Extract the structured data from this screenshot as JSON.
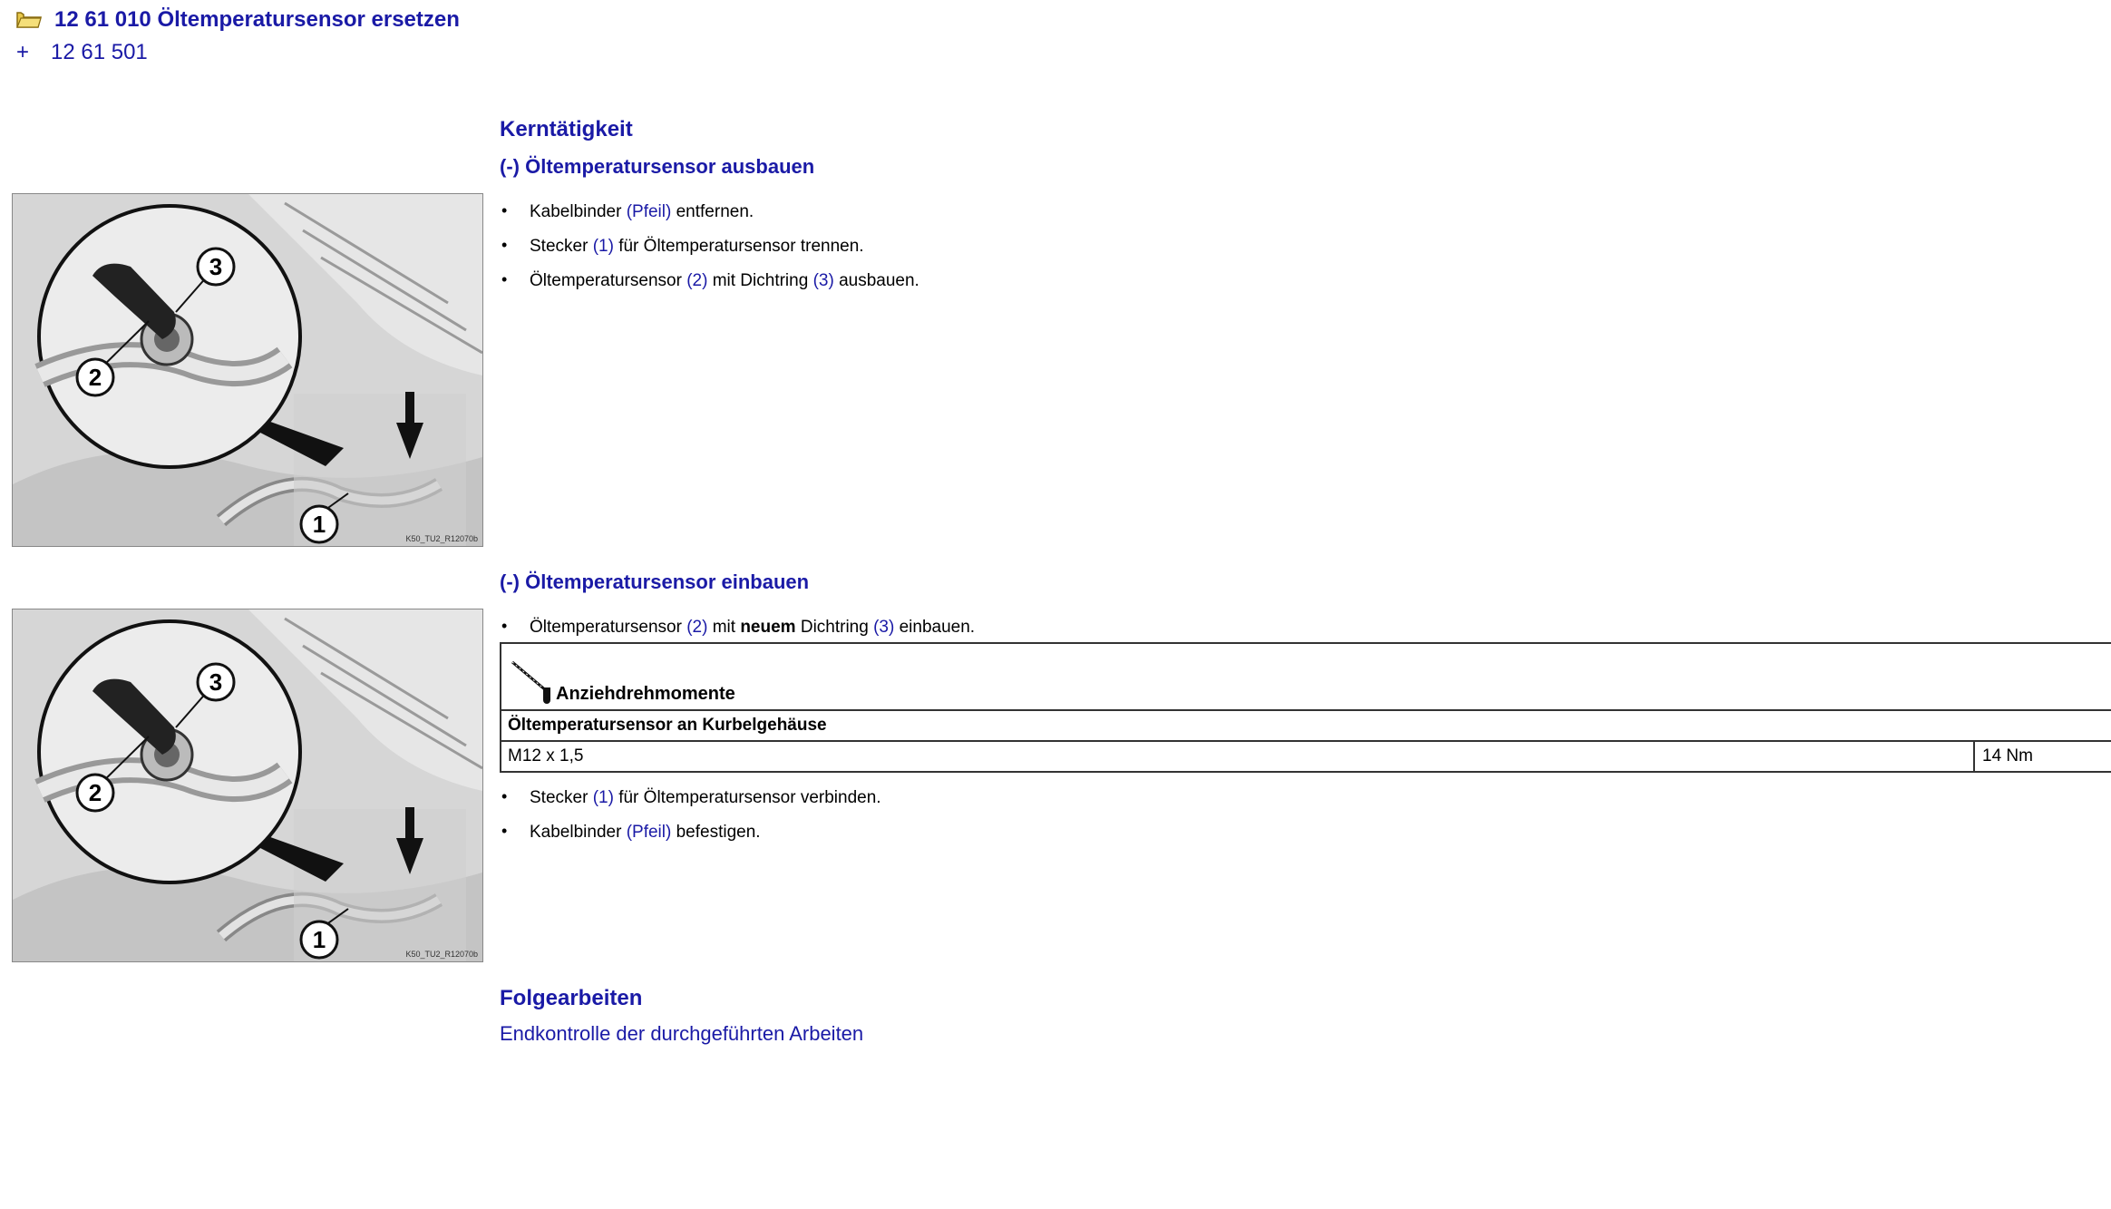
{
  "header": {
    "title": "12 61 010 Öltemperatursensor ersetzen",
    "ref_plus": "+",
    "ref_code": "12 61 501"
  },
  "main": {
    "heading": "Kerntätigkeit",
    "section1": {
      "title": "(-) Öltemperatursensor ausbauen",
      "steps": [
        {
          "pre": "Kabelbinder ",
          "ref": "(Pfeil)",
          "post": " entfernen."
        },
        {
          "pre": "Stecker ",
          "ref": "(1)",
          "post": " für Öltemperatursensor trennen."
        },
        {
          "pre": "Öltemperatursensor ",
          "ref": "(2)",
          "mid": " mit Dichtring ",
          "ref2": "(3)",
          "post": " ausbauen."
        }
      ]
    },
    "section2": {
      "title": "(-) Öltemperatursensor einbauen",
      "step1": {
        "pre": "Öltemperatursensor ",
        "ref": "(2)",
        "mid_a": " mit ",
        "bold": "neuem",
        "mid_b": " Dichtring ",
        "ref2": "(3)",
        "post": " einbauen."
      },
      "torque": {
        "header": "Anziehdrehmomente",
        "row_title": "Öltemperatursensor an Kurbelgehäuse",
        "thread": "M12 x 1,5",
        "value": "14 Nm"
      },
      "steps": [
        {
          "pre": "Stecker ",
          "ref": "(1)",
          "post": " für Öltemperatursensor verbinden."
        },
        {
          "pre": "Kabelbinder ",
          "ref": "(Pfeil)",
          "post": " befestigen."
        }
      ]
    },
    "followup": {
      "heading": "Folgearbeiten",
      "link": "Endkontrolle der durchgeführten Arbeiten"
    },
    "figure": {
      "callouts": [
        "1",
        "2",
        "3"
      ],
      "code": "K50_TU2_R12070b"
    },
    "bullet": "•"
  }
}
